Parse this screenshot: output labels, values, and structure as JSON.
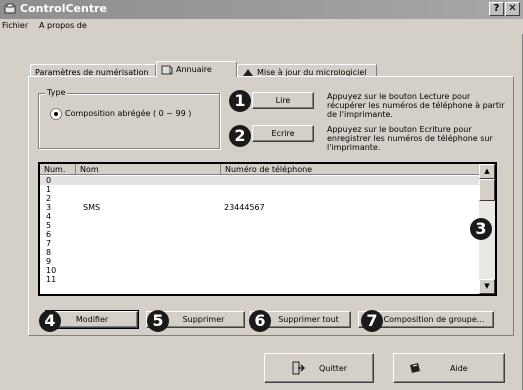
{
  "window": {
    "title": "ControlCentre",
    "help_glyph": "?",
    "close_glyph": "✕",
    "app_icon": "controlcentre-icon"
  },
  "menu": {
    "items": [
      "Fichier",
      "A propos de"
    ]
  },
  "tabs": [
    {
      "label": "Paramètres de numérisation",
      "icon": null
    },
    {
      "label": "Annuaire",
      "icon": "phonebook-icon"
    },
    {
      "label": "Mise à jour du micrologiciel",
      "icon": "update-icon"
    }
  ],
  "type_group": {
    "legend": "Type",
    "option_label": "Composition abrégée ( 0 ~ 99 )"
  },
  "read": {
    "callout": "1",
    "button": "Lire",
    "description": "Appuyez sur le bouton Lecture pour récupérer les numéros de téléphone à partir de l'imprimante."
  },
  "write": {
    "callout": "2",
    "button": "Ecrire",
    "description": "Appuyez sur le bouton Ecriture pour enregistrer les numéros de téléphone sur l'imprimante."
  },
  "list": {
    "callout": "3",
    "columns": [
      "Num.",
      "Nom",
      "Numéro de téléphone"
    ],
    "rows": [
      {
        "num": "0",
        "name": "",
        "phone": ""
      },
      {
        "num": "1",
        "name": "",
        "phone": ""
      },
      {
        "num": "2",
        "name": "",
        "phone": ""
      },
      {
        "num": "3",
        "name": "SMS",
        "phone": "23444567"
      },
      {
        "num": "4",
        "name": "",
        "phone": ""
      },
      {
        "num": "5",
        "name": "",
        "phone": ""
      },
      {
        "num": "6",
        "name": "",
        "phone": ""
      },
      {
        "num": "7",
        "name": "",
        "phone": ""
      },
      {
        "num": "8",
        "name": "",
        "phone": ""
      },
      {
        "num": "9",
        "name": "",
        "phone": ""
      },
      {
        "num": "10",
        "name": "",
        "phone": ""
      },
      {
        "num": "11",
        "name": "",
        "phone": ""
      }
    ],
    "scroll_up_glyph": "▲",
    "scroll_down_glyph": "▼"
  },
  "actions": [
    {
      "callout": "4",
      "label": "Modifier"
    },
    {
      "callout": "5",
      "label": "Supprimer"
    },
    {
      "callout": "6",
      "label": "Supprimer tout"
    },
    {
      "callout": "7",
      "label": "Composition de groupe..."
    }
  ],
  "footer": {
    "quit_label": "Quitter",
    "quit_icon": "exit-icon",
    "help_label": "Aide",
    "help_icon": "help-icon"
  }
}
